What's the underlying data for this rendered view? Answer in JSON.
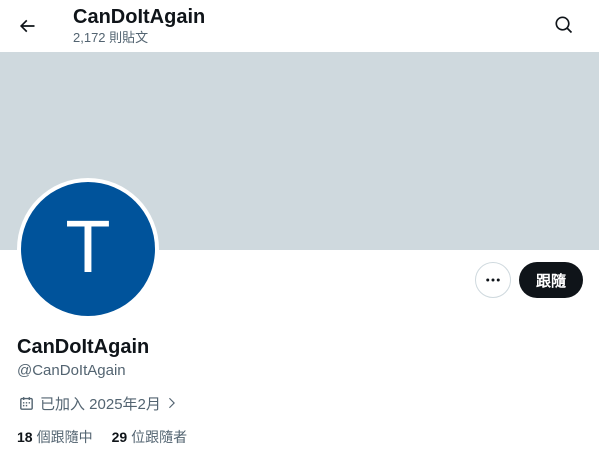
{
  "header": {
    "back_icon": "arrow-left-icon",
    "title": "CanDoItAgain",
    "post_count": "2,172 則貼文",
    "search_icon": "search-icon"
  },
  "banner": {
    "color": "#cfd9de"
  },
  "avatar": {
    "letter": "T",
    "color": "#00539b"
  },
  "actions": {
    "more_icon": "more-horizontal-icon",
    "follow_label": "跟隨"
  },
  "profile": {
    "display_name": "CanDoItAgain",
    "handle": "@CanDoItAgain",
    "joined_text": "已加入 2025年2月",
    "calendar_icon": "calendar-icon",
    "chevron_icon": "chevron-right-icon"
  },
  "stats": {
    "following_count": "18",
    "following_label": "個跟隨中",
    "followers_count": "29",
    "followers_label": "位跟隨者"
  },
  "colors": {
    "text_primary": "#0f1419",
    "text_secondary": "#536471",
    "follow_bg": "#0f1419",
    "border": "#cfd9de"
  }
}
